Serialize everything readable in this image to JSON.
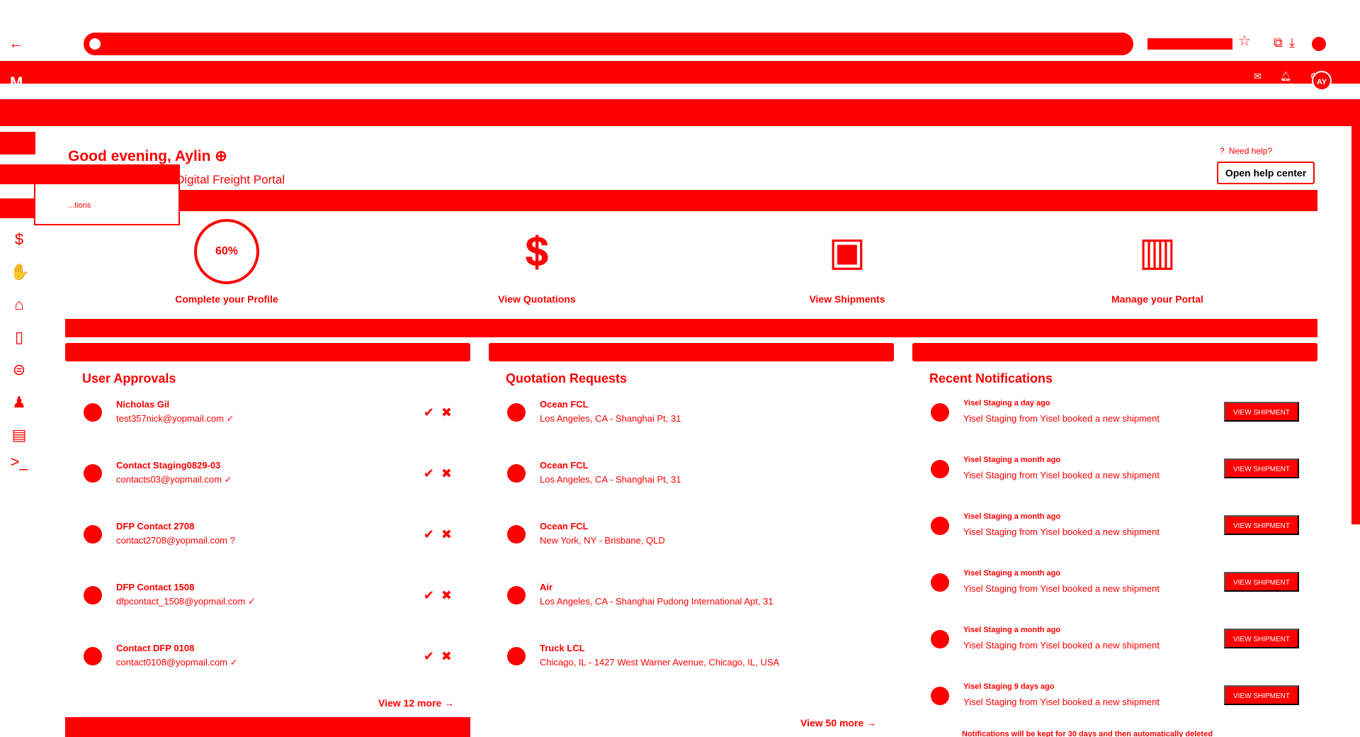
{
  "browser": {
    "back_icon": "arrow-left",
    "star_icon": "star",
    "extensions_icon": "puzzle",
    "downloads_icon": "download"
  },
  "topbar": {
    "logo": "M",
    "avatar_initials": "AY",
    "icons": [
      "chat-icon",
      "bell-icon",
      "gear-icon"
    ]
  },
  "greeting": {
    "title": "Good evening, Aylin ⊕",
    "subtitle": "Get started with the Digital Freight Portal",
    "help_text": "Need help?",
    "help_button": "Open help center",
    "dropdown_item": "...tions"
  },
  "quick_actions": [
    {
      "label": "Complete your Profile",
      "progress": "60%"
    },
    {
      "label": "View Quotations"
    },
    {
      "label": "View Shipments"
    },
    {
      "label": "Manage your Portal"
    }
  ],
  "approvals": {
    "title": "User Approvals",
    "view_more": "View 12 more",
    "rows": [
      {
        "name": "Nicholas Gil",
        "email": "test357nick@yopmail.com",
        "status": "✓"
      },
      {
        "name": "Contact Staging0829-03",
        "email": "contacts03@yopmail.com",
        "status": "✓"
      },
      {
        "name": "DFP Contact 2708",
        "email": "contact2708@yopmail.com",
        "status": "?"
      },
      {
        "name": "DFP Contact 1508",
        "email": "dfpcontact_1508@yopmail.com",
        "status": "✓"
      },
      {
        "name": "Contact DFP 0108",
        "email": "contact0108@yopmail.com",
        "status": "✓"
      }
    ]
  },
  "quotations": {
    "title": "Quotation Requests",
    "view_more": "View 50 more",
    "rows": [
      {
        "mode": "Ocean FCL",
        "route": "Los Angeles, CA - Shanghai Pt, 31"
      },
      {
        "mode": "Ocean FCL",
        "route": "Los Angeles, CA - Shanghai Pt, 31"
      },
      {
        "mode": "Ocean FCL",
        "route": "New York, NY - Brisbane, QLD"
      },
      {
        "mode": "Air",
        "route": "Los Angeles, CA - Shanghai Pudong International Apt, 31"
      },
      {
        "mode": "Truck LCL",
        "route": "Chicago, IL - 1427 West Warner Avenue, Chicago, IL, USA"
      }
    ]
  },
  "notifications": {
    "title": "Recent Notifications",
    "footnote": "Notifications will be kept for 30 days and then automatically deleted",
    "rows": [
      {
        "meta": "Yisel Staging a day ago",
        "text": "Yisel Staging from Yisel booked a new shipment",
        "button": "VIEW SHIPMENT"
      },
      {
        "meta": "Yisel Staging a month ago",
        "text": "Yisel Staging from Yisel booked a new shipment",
        "button": "VIEW SHIPMENT"
      },
      {
        "meta": "Yisel Staging a month ago",
        "text": "Yisel Staging from Yisel booked a new shipment",
        "button": "VIEW SHIPMENT"
      },
      {
        "meta": "Yisel Staging a month ago",
        "text": "Yisel Staging from Yisel booked a new shipment",
        "button": "VIEW SHIPMENT"
      },
      {
        "meta": "Yisel Staging a month ago",
        "text": "Yisel Staging from Yisel booked a new shipment",
        "button": "VIEW SHIPMENT"
      },
      {
        "meta": "Yisel Staging 9 days ago",
        "text": "Yisel Staging from Yisel booked a new shipment",
        "button": "VIEW SHIPMENT"
      }
    ]
  },
  "colors": {
    "accent": "#ff0000",
    "background": "#ffffff"
  }
}
